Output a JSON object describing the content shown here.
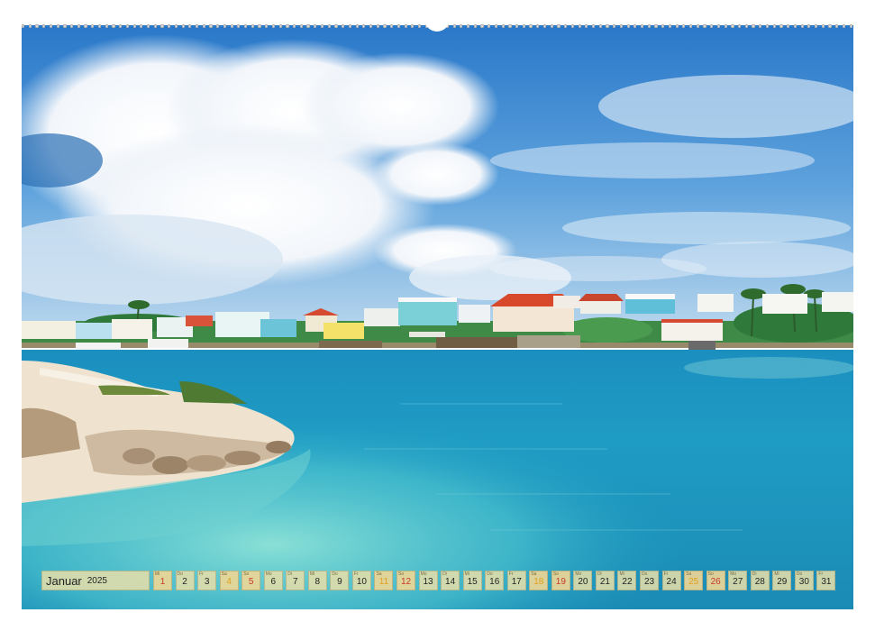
{
  "calendar": {
    "month": "Januar",
    "year": "2025",
    "days": [
      {
        "wd": "Mi",
        "d": "1",
        "kind": "holiday"
      },
      {
        "wd": "Do",
        "d": "2",
        "kind": "weekday"
      },
      {
        "wd": "Fr",
        "d": "3",
        "kind": "weekday"
      },
      {
        "wd": "Sa",
        "d": "4",
        "kind": "weekend"
      },
      {
        "wd": "So",
        "d": "5",
        "kind": "sunday"
      },
      {
        "wd": "Mo",
        "d": "6",
        "kind": "weekday"
      },
      {
        "wd": "Di",
        "d": "7",
        "kind": "weekday"
      },
      {
        "wd": "Mi",
        "d": "8",
        "kind": "weekday"
      },
      {
        "wd": "Do",
        "d": "9",
        "kind": "weekday"
      },
      {
        "wd": "Fr",
        "d": "10",
        "kind": "weekday"
      },
      {
        "wd": "Sa",
        "d": "11",
        "kind": "weekend"
      },
      {
        "wd": "So",
        "d": "12",
        "kind": "sunday"
      },
      {
        "wd": "Mo",
        "d": "13",
        "kind": "weekday"
      },
      {
        "wd": "Di",
        "d": "14",
        "kind": "weekday"
      },
      {
        "wd": "Mi",
        "d": "15",
        "kind": "weekday"
      },
      {
        "wd": "Do",
        "d": "16",
        "kind": "weekday"
      },
      {
        "wd": "Fr",
        "d": "17",
        "kind": "weekday"
      },
      {
        "wd": "Sa",
        "d": "18",
        "kind": "weekend"
      },
      {
        "wd": "So",
        "d": "19",
        "kind": "sunday"
      },
      {
        "wd": "Mo",
        "d": "20",
        "kind": "weekday"
      },
      {
        "wd": "Di",
        "d": "21",
        "kind": "weekday"
      },
      {
        "wd": "Mi",
        "d": "22",
        "kind": "weekday"
      },
      {
        "wd": "Do",
        "d": "23",
        "kind": "weekday"
      },
      {
        "wd": "Fr",
        "d": "24",
        "kind": "weekday"
      },
      {
        "wd": "Sa",
        "d": "25",
        "kind": "weekend"
      },
      {
        "wd": "So",
        "d": "26",
        "kind": "sunday"
      },
      {
        "wd": "Mo",
        "d": "27",
        "kind": "weekday"
      },
      {
        "wd": "Di",
        "d": "28",
        "kind": "weekday"
      },
      {
        "wd": "Mi",
        "d": "29",
        "kind": "weekday"
      },
      {
        "wd": "Do",
        "d": "30",
        "kind": "weekday"
      },
      {
        "wd": "Fr",
        "d": "31",
        "kind": "weekday"
      }
    ]
  },
  "colors": {
    "sky_top": "#2f7fd0",
    "sky_bottom": "#9cc6e8",
    "sea_light": "#6fd3d6",
    "sea_deep": "#1a7fb3",
    "sunday_red": "#c8382c",
    "holiday_orange": "#e0a020",
    "calendar_cell": "#e4deaa"
  }
}
